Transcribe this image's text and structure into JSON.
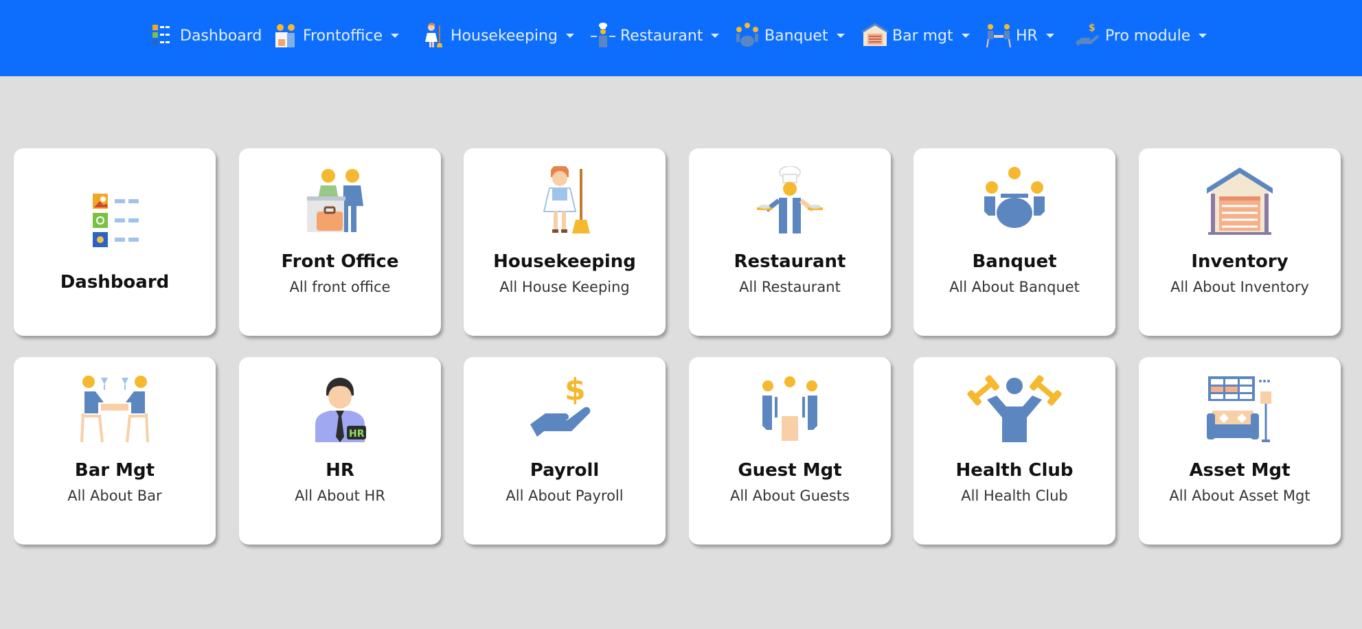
{
  "nav": {
    "items": [
      {
        "label": "Dashboard",
        "icon": "dashboard-icon",
        "dropdown": false
      },
      {
        "label": "Frontoffice",
        "icon": "frontoffice-icon",
        "dropdown": true
      },
      {
        "label": "Housekeeping",
        "icon": "housekeeping-icon",
        "dropdown": true
      },
      {
        "label": "Restaurant",
        "icon": "restaurant-icon",
        "dropdown": true
      },
      {
        "label": "Banquet",
        "icon": "banquet-icon",
        "dropdown": true
      },
      {
        "label": "Bar mgt",
        "icon": "bar-mgt-icon",
        "dropdown": true
      },
      {
        "label": "HR",
        "icon": "hr-icon",
        "dropdown": true
      },
      {
        "label": "Pro module",
        "icon": "pro-module-icon",
        "dropdown": true
      }
    ]
  },
  "cards": [
    {
      "title": "Dashboard",
      "subtitle": "",
      "icon": "dashboard-icon"
    },
    {
      "title": "Front Office",
      "subtitle": "All front office",
      "icon": "front-office-icon"
    },
    {
      "title": "Housekeeping",
      "subtitle": "All House Keeping",
      "icon": "housekeeping-icon"
    },
    {
      "title": "Restaurant",
      "subtitle": "All Restaurant",
      "icon": "restaurant-icon"
    },
    {
      "title": "Banquet",
      "subtitle": "All About Banquet",
      "icon": "banquet-icon"
    },
    {
      "title": "Inventory",
      "subtitle": "All About Inventory",
      "icon": "inventory-icon"
    },
    {
      "title": "Bar Mgt",
      "subtitle": "All About Bar",
      "icon": "bar-mgt-icon"
    },
    {
      "title": "HR",
      "subtitle": "All About HR",
      "icon": "hr-icon"
    },
    {
      "title": "Payroll",
      "subtitle": "All About Payroll",
      "icon": "payroll-icon"
    },
    {
      "title": "Guest Mgt",
      "subtitle": "All About Guests",
      "icon": "guest-mgt-icon"
    },
    {
      "title": "Health Club",
      "subtitle": "All Health Club",
      "icon": "health-club-icon"
    },
    {
      "title": "Asset Mgt",
      "subtitle": "All About Asset Mgt",
      "icon": "asset-mgt-icon"
    }
  ],
  "colors": {
    "navbar": "#0d6efd",
    "page_background": "#dedede",
    "card_background": "#ffffff",
    "icon_blue": "#5b86c0",
    "icon_yellow": "#f5b82e",
    "icon_peach": "#f8cfa7"
  }
}
